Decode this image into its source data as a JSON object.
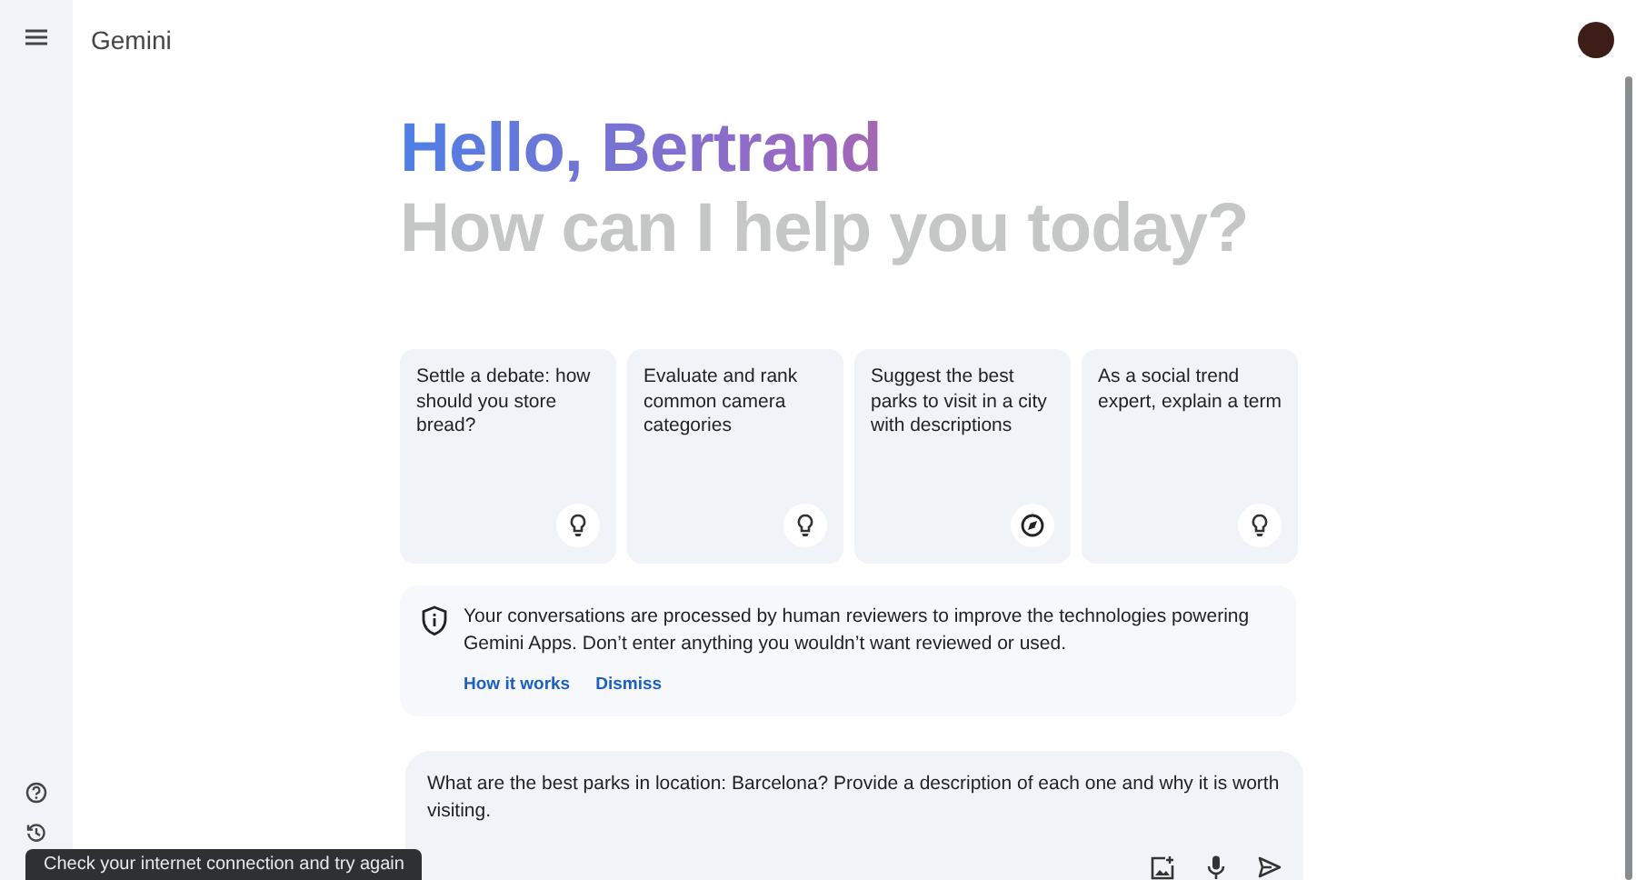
{
  "app": {
    "title": "Gemini"
  },
  "greeting": {
    "hello": "Hello, Bertrand",
    "question": "How can I help you today?"
  },
  "suggestions": [
    {
      "text": "Settle a debate: how should you store bread?",
      "kind": "idea"
    },
    {
      "text": "Evaluate and rank common camera categories",
      "kind": "idea"
    },
    {
      "text": "Suggest the best parks to visit in a city with descriptions",
      "kind": "explore"
    },
    {
      "text": "As a social trend expert, explain a term",
      "kind": "idea"
    }
  ],
  "notice": {
    "text": "Your conversations are processed by human reviewers to improve the technologies powering Gemini Apps. Don’t enter anything you wouldn’t want reviewed or used.",
    "links": [
      "How it works",
      "Dismiss"
    ]
  },
  "prompt": {
    "value": "What are the best parks in location: Barcelona? Provide a description of each one and why it is worth visiting."
  },
  "toast": {
    "text": "Check your internet connection and try again"
  }
}
